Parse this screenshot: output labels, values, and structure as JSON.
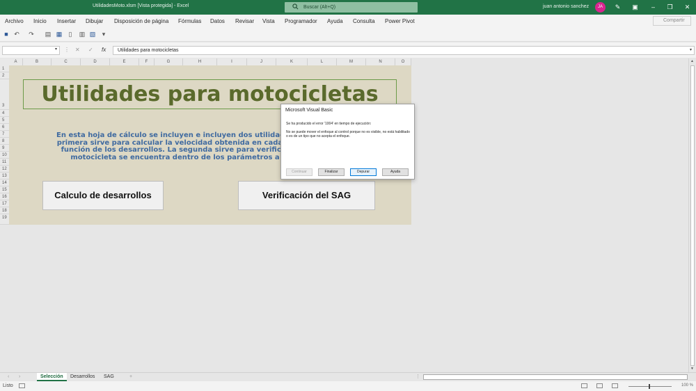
{
  "titlebar": {
    "doc_title": "UtilidadesMoto.xlsm  [Vista protegida]  -  Excel",
    "search_placeholder": "Buscar (Alt+Q)",
    "user_name": "juan antonio sanchez",
    "avatar_initials": "JA",
    "accent_color": "#217346"
  },
  "menu": {
    "items": [
      "Archivo",
      "Inicio",
      "Insertar",
      "Dibujar",
      "Disposición de página",
      "Fórmulas",
      "Datos",
      "Revisar",
      "Vista",
      "Programador",
      "Ayuda",
      "Consulta",
      "Power Pivot"
    ],
    "share_label": "Compartir"
  },
  "formula_bar": {
    "name_box": "",
    "fx_label": "fx",
    "content": "Utilidades para motocicletas"
  },
  "columns": [
    "A",
    "B",
    "C",
    "D",
    "E",
    "F",
    "G",
    "H",
    "I",
    "J",
    "K",
    "L",
    "M",
    "N",
    "O"
  ],
  "rows": [
    "1",
    "2",
    "3",
    "4",
    "5",
    "6",
    "7",
    "8",
    "9",
    "10",
    "11",
    "12",
    "13",
    "14",
    "15",
    "16",
    "17",
    "18",
    "19"
  ],
  "sheet": {
    "banner_title": "Utilidades para motocicletas",
    "description_lines": [
      "En esta hoja de cálculo se incluyen e incluyen dos utilidades",
      "primera sirve para  calcular la velocidad obtenida en cada re",
      "función de los desarrollos. La segunda sirve para verificar",
      "motocicleta se encuentra dentro de los parámetros a"
    ],
    "button_desarrollos": "Calculo de desarrollos",
    "button_sag": "Verificación del SAG"
  },
  "dialog": {
    "title": "Microsoft Visual Basic",
    "error_line": "Se ha producido el error '1004' en tiempo de ejecución:",
    "message": "No se puede mover el enfoque al control porque no es visible, no está habilitado o es de un tipo que no acepta el enfoque.",
    "buttons": {
      "continue": "Continuar",
      "end": "Finalizar",
      "debug": "Depurar",
      "help": "Ayuda"
    }
  },
  "tabs": {
    "items": [
      "Selección",
      "Desarrollos",
      "SAG"
    ],
    "active": "Selección",
    "add_symbol": "+"
  },
  "status": {
    "ready": "Listo",
    "zoom": "100 %"
  }
}
